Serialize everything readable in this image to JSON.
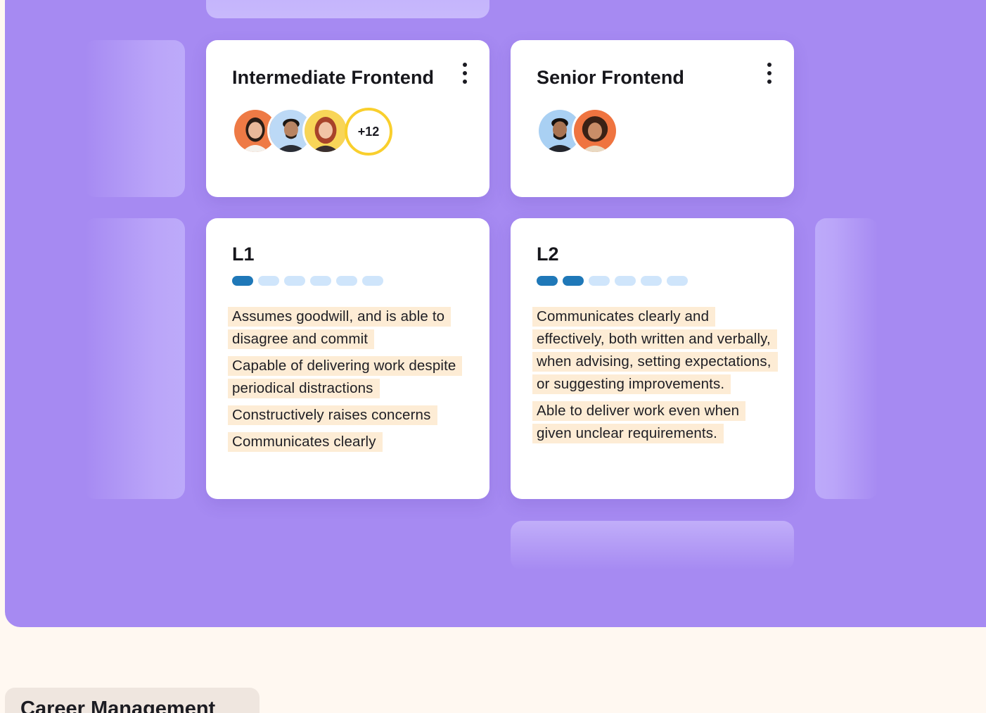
{
  "colors": {
    "panel": "#a68af2",
    "card": "#ffffff",
    "highlight": "#fdecd5",
    "dot_active": "#1f78b8",
    "dot_inactive": "#cfe5fb",
    "badge_ring": "#f9cf2d",
    "page_bg": "#fff8f1"
  },
  "role_cards": [
    {
      "title": "Intermediate Frontend",
      "menu_icon": "kebab-menu-icon",
      "avatars": [
        "avatar-woman-orange-bg",
        "avatar-man-blue-bg",
        "avatar-woman-yellow-bg"
      ],
      "more_count": "+12"
    },
    {
      "title": "Senior Frontend",
      "menu_icon": "kebab-menu-icon",
      "avatars": [
        "avatar-man-blue-bg",
        "avatar-woman-orange-bg"
      ],
      "more_count": ""
    }
  ],
  "levels": [
    {
      "title": "L1",
      "filled_steps": 1,
      "total_steps": 6,
      "skills": [
        "Assumes goodwill, and is able to disagree and commit",
        "Capable of delivering work despite periodical distractions",
        "Constructively raises concerns",
        "Communicates clearly"
      ]
    },
    {
      "title": "L2",
      "filled_steps": 2,
      "total_steps": 6,
      "skills": [
        "Communicates clearly and effectively, both written and verbally, when advising, setting expectations, or suggesting improvements.",
        "Able to deliver work even when given unclear requirements."
      ]
    }
  ],
  "section_tab": {
    "label": "Career Management"
  }
}
